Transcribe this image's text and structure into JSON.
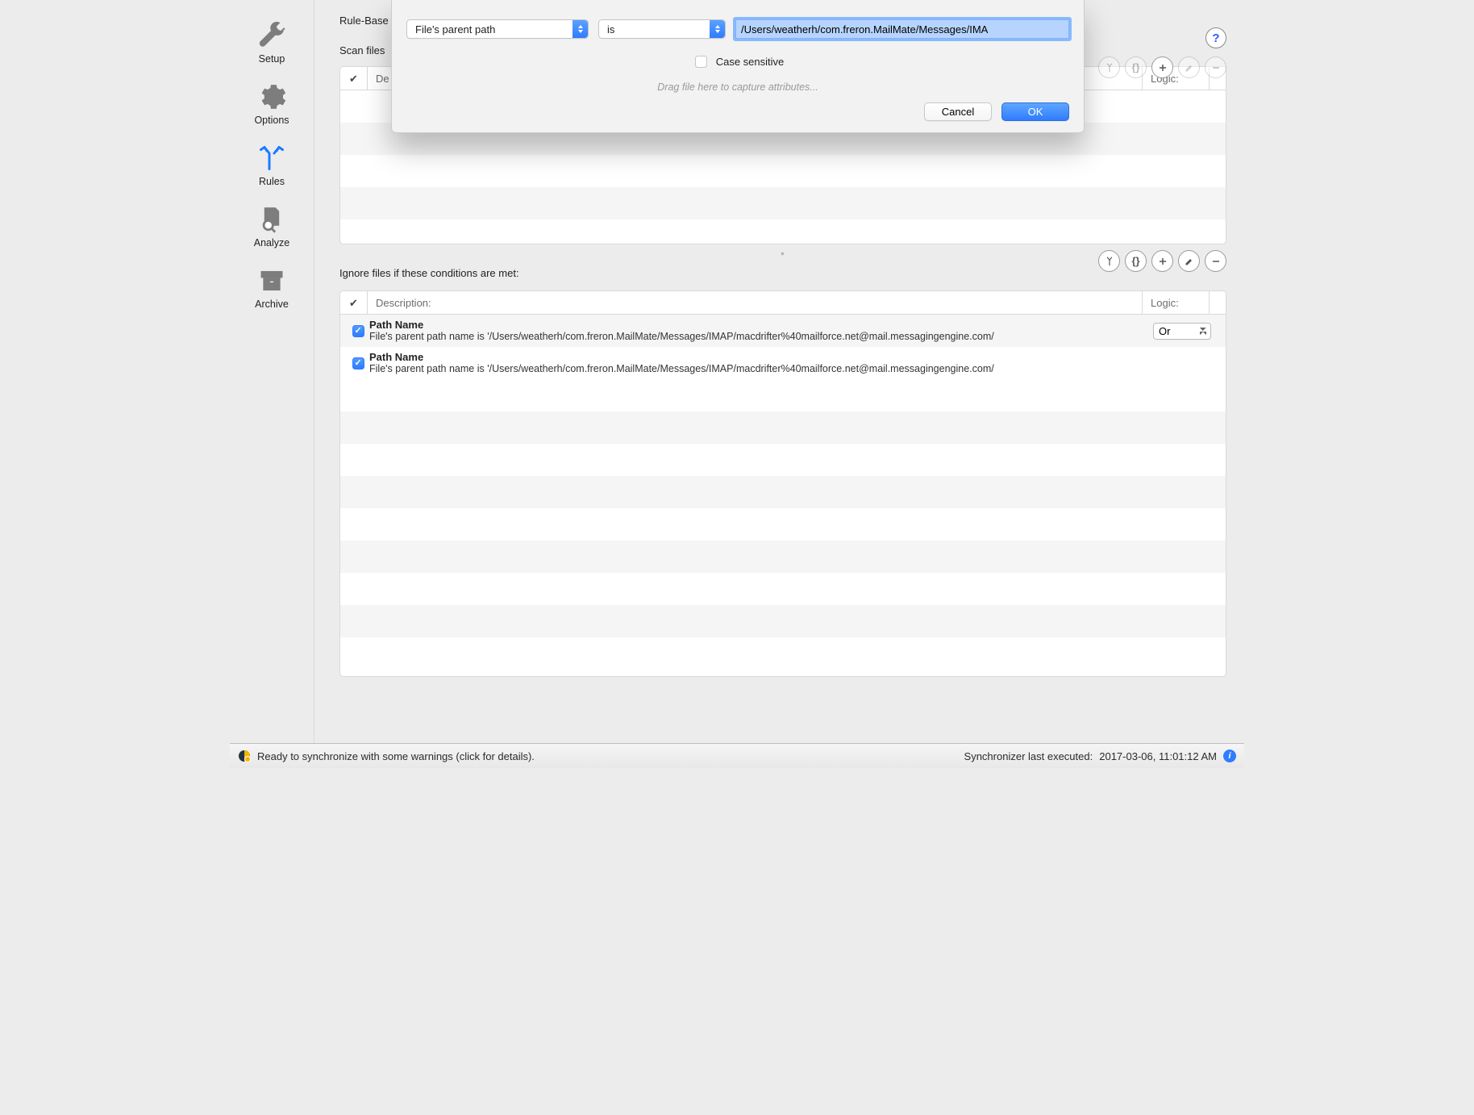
{
  "sidebar": {
    "items": [
      {
        "label": "Setup",
        "active": false
      },
      {
        "label": "Options",
        "active": false
      },
      {
        "label": "Rules",
        "active": true
      },
      {
        "label": "Analyze",
        "active": false
      },
      {
        "label": "Archive",
        "active": false
      }
    ]
  },
  "section1": {
    "heading_partial": "Rule-Base",
    "label_partial": "Scan files"
  },
  "section2": {
    "label": "Ignore files if these conditions are met:"
  },
  "table_header": {
    "check": "✔",
    "description_full": "Description:",
    "description_partial": "De",
    "logic": "Logic:"
  },
  "ignore_rules": [
    {
      "enabled": true,
      "title": "Path Name",
      "subtitle": "File's parent path name is '/Users/weatherh/com.freron.MailMate/Messages/IMAP/macdrifter%40mailforce.net@mail.messagingengine.com/",
      "logic": "Or"
    },
    {
      "enabled": true,
      "title": "Path Name",
      "subtitle": "File's parent path name is '/Users/weatherh/com.freron.MailMate/Messages/IMAP/macdrifter%40mailforce.net@mail.messagingengine.com/",
      "logic": ""
    }
  ],
  "toolbar_icons": {
    "branch": "branch",
    "braces": "braces",
    "plus": "plus",
    "edit": "edit",
    "minus": "minus"
  },
  "help": "?",
  "modal": {
    "attribute_select": "File's parent path",
    "operator_select": "is",
    "value_input": "/Users/weatherh/com.freron.MailMate/Messages/IMA",
    "case_sensitive_label": "Case sensitive",
    "case_sensitive_checked": false,
    "drag_hint": "Drag file here to capture attributes...",
    "cancel": "Cancel",
    "ok": "OK"
  },
  "statusbar": {
    "left": "Ready to synchronize with some warnings (click for details).",
    "right_label": "Synchronizer last executed:",
    "right_time": "2017-03-06, 11:01:12 AM"
  }
}
